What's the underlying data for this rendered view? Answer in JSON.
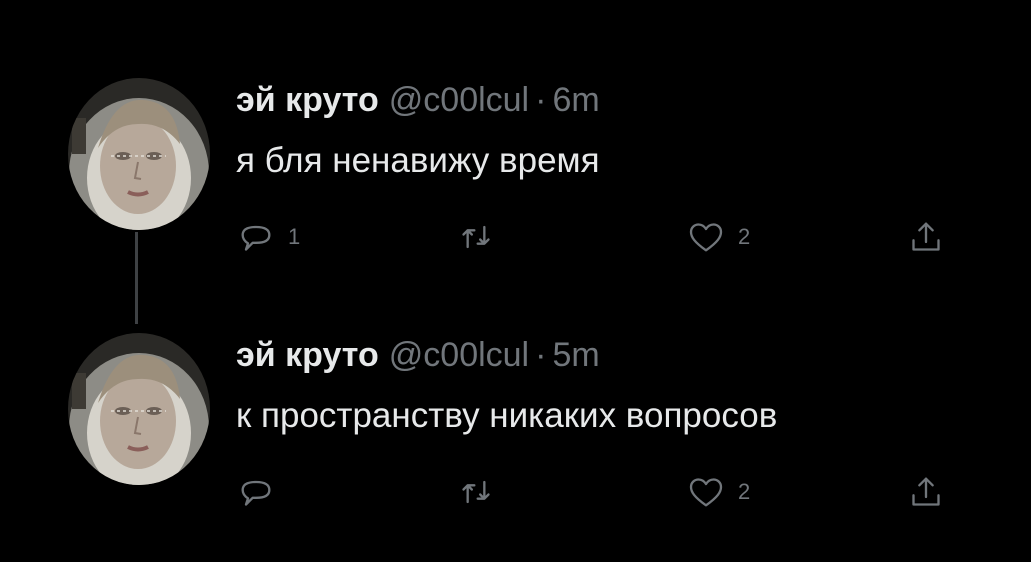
{
  "colors": {
    "background": "#000000",
    "primary_text": "#e7e9ea",
    "secondary_text": "#71767b",
    "thread_line": "#3e4144"
  },
  "tweets": [
    {
      "name": "эй круто",
      "handle": "@c00lcul",
      "separator": "·",
      "time": "6m",
      "text": "я бля ненавижу время",
      "reply_count": "1",
      "retweet_count": "",
      "like_count": "2",
      "icons": [
        "reply-icon",
        "retweet-icon",
        "like-icon",
        "share-icon"
      ]
    },
    {
      "name": "эй круто",
      "handle": "@c00lcul",
      "separator": "·",
      "time": "5m",
      "text": "к пространству никаких вопросов",
      "reply_count": "",
      "retweet_count": "",
      "like_count": "2",
      "icons": [
        "reply-icon",
        "retweet-icon",
        "like-icon",
        "share-icon"
      ]
    }
  ]
}
